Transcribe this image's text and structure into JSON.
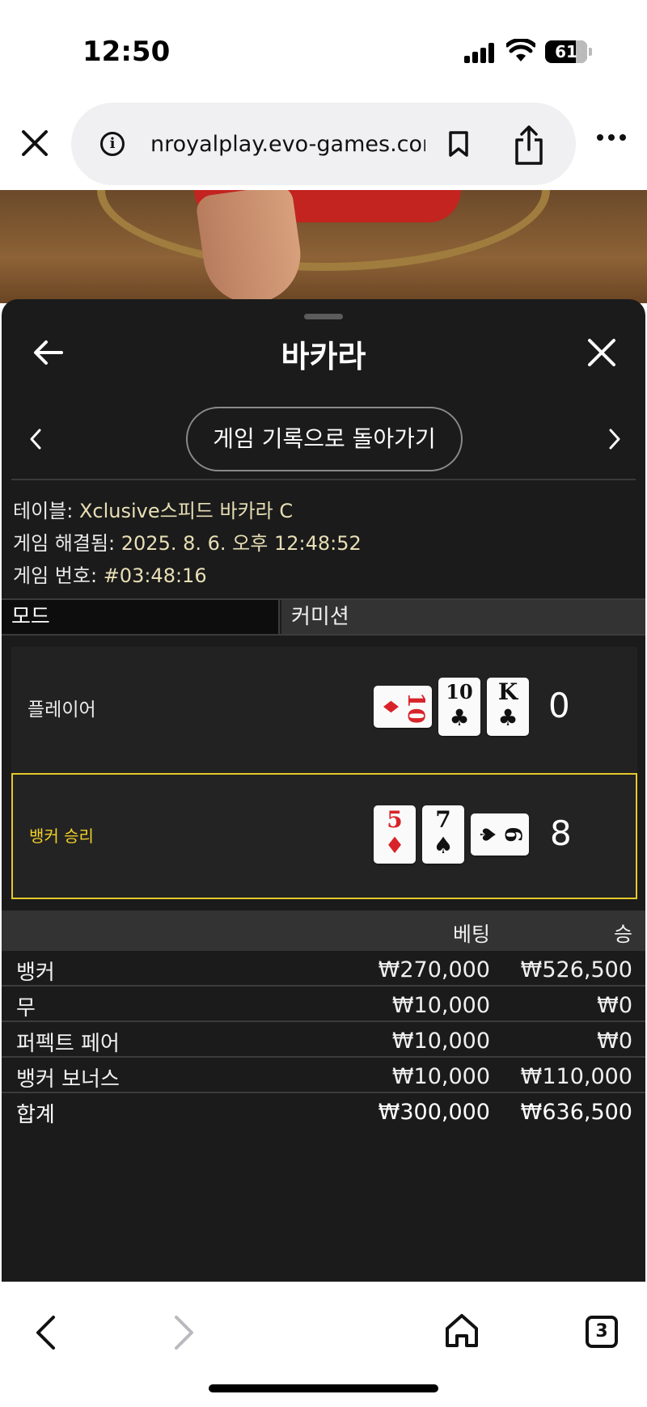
{
  "status_bar": {
    "time": "12:50",
    "battery": "61"
  },
  "browser": {
    "url": "nroyalplay.evo-games.com",
    "tab_count": "3"
  },
  "panel": {
    "title": "바카라",
    "back_to_history": "게임 기록으로 돌아가기",
    "meta": {
      "table_label": "테이블:",
      "table_value": "Xclusive스피드 바카라 C",
      "resolved_label": "게임 해결됨:",
      "resolved_value": "2025. 8. 6. 오후 12:48:52",
      "number_label": "게임 번호:",
      "number_value": "#03:48:16"
    },
    "mode": {
      "label": "모드",
      "value": "커미션"
    },
    "hands": {
      "player": {
        "label": "플레이어",
        "score": "0",
        "cards": [
          {
            "rank": "10",
            "suit": "♦",
            "color": "red",
            "orientation": "sideways"
          },
          {
            "rank": "10",
            "suit": "♣",
            "color": "black",
            "orientation": "upright"
          },
          {
            "rank": "K",
            "suit": "♣",
            "color": "black",
            "orientation": "upright"
          }
        ]
      },
      "banker": {
        "label": "뱅커 승리",
        "score": "8",
        "cards": [
          {
            "rank": "5",
            "suit": "♦",
            "color": "red",
            "orientation": "upright"
          },
          {
            "rank": "7",
            "suit": "♠",
            "color": "black",
            "orientation": "upright"
          },
          {
            "rank": "6",
            "suit": "♠",
            "color": "black",
            "orientation": "sideways"
          }
        ]
      }
    },
    "bets": {
      "headers": {
        "bet": "베팅",
        "win": "승"
      },
      "rows": [
        {
          "name": "뱅커",
          "bet": "₩270,000",
          "win": "₩526,500"
        },
        {
          "name": "무",
          "bet": "₩10,000",
          "win": "₩0"
        },
        {
          "name": "퍼펙트 페어",
          "bet": "₩10,000",
          "win": "₩0"
        },
        {
          "name": "뱅커 보너스",
          "bet": "₩10,000",
          "win": "₩110,000"
        }
      ],
      "total": {
        "name": "합계",
        "bet": "₩300,000",
        "win": "₩636,500"
      }
    }
  },
  "colors": {
    "highlight": "#e5c92a",
    "panel_bg": "#1b1b1b",
    "meta_text": "#e8dfb6",
    "card_red": "#d8232a"
  }
}
